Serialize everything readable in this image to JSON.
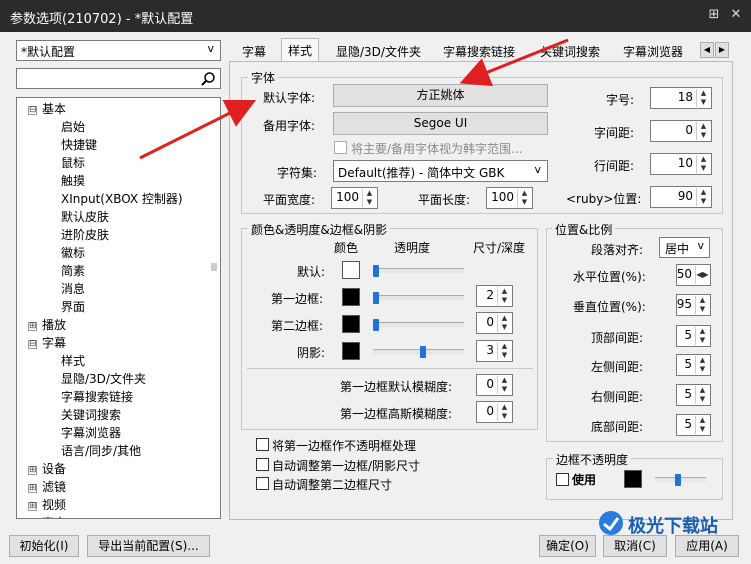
{
  "window": {
    "title": "参数选项(210702) - *默认配置",
    "pin_icon": "pin-icon",
    "close_icon": "close-icon"
  },
  "profile": {
    "selected": "*默认配置",
    "search_value": ""
  },
  "tree": [
    {
      "label": "基本",
      "expander": "⊟"
    },
    {
      "label": "启始"
    },
    {
      "label": "快捷键"
    },
    {
      "label": "鼠标"
    },
    {
      "label": "触摸"
    },
    {
      "label": "XInput(XBOX 控制器)"
    },
    {
      "label": "默认皮肤"
    },
    {
      "label": "进阶皮肤"
    },
    {
      "label": "徽标"
    },
    {
      "label": "简素"
    },
    {
      "label": "消息"
    },
    {
      "label": "界面"
    },
    {
      "label": "播放",
      "expander": "⊞"
    },
    {
      "label": "字幕",
      "expander": "⊟"
    },
    {
      "label": "样式"
    },
    {
      "label": "显隐/3D/文件夹"
    },
    {
      "label": "字幕搜索链接"
    },
    {
      "label": "关键词搜索"
    },
    {
      "label": "字幕浏览器"
    },
    {
      "label": "语言/同步/其他"
    },
    {
      "label": "设备",
      "expander": "⊞"
    },
    {
      "label": "滤镜",
      "expander": "⊞"
    },
    {
      "label": "视频",
      "expander": "⊞"
    },
    {
      "label": "声音",
      "expander": "⊞"
    }
  ],
  "tabs": [
    "字幕",
    "样式",
    "显隐/3D/文件夹",
    "字幕搜索链接",
    "关键词搜索",
    "字幕浏览器"
  ],
  "font": {
    "group": "字体",
    "default_label": "默认字体:",
    "default_value": "方正姚体",
    "backup_label": "备用字体:",
    "backup_value": "Segoe UI",
    "korean_checkbox": "将主要/备用字体视为韩字范围...",
    "charset_label": "字符集:",
    "charset_value": "Default(推荐) - 简体中文 GBK",
    "width_label": "平面宽度:",
    "width_value": "100",
    "length_label": "平面长度:",
    "length_value": "100",
    "size_label": "字号:",
    "size_value": "18",
    "spacing_label": "字间距:",
    "spacing_value": "0",
    "line_label": "行间距:",
    "line_value": "10",
    "ruby_label": "<ruby>位置:",
    "ruby_value": "90"
  },
  "colors": {
    "group": "颜色&透明度&边框&阴影",
    "col_color": "颜色",
    "col_opacity": "透明度",
    "col_size": "尺寸/深度",
    "rows": [
      {
        "label": "默认:",
        "color": "#ffffff",
        "opacity": 0.0,
        "size": ""
      },
      {
        "label": "第一边框:",
        "color": "#000000",
        "opacity": 0.0,
        "size": "2"
      },
      {
        "label": "第二边框:",
        "color": "#000000",
        "opacity": 0.0,
        "size": "0"
      },
      {
        "label": "阴影:",
        "color": "#000000",
        "opacity": 0.55,
        "size": "3"
      }
    ],
    "blur1_label": "第一边框默认模糊度:",
    "blur1_value": "0",
    "blur2_label": "第一边框高斯模糊度:",
    "blur2_value": "0"
  },
  "checks": [
    "将第一边框作不透明框处理",
    "自动调整第一边框/阴影尺寸",
    "自动调整第二边框尺寸"
  ],
  "position": {
    "group": "位置&比例",
    "align_label": "段落对齐:",
    "align_value": "居中",
    "h_label": "水平位置(%):",
    "h_value": "50",
    "v_label": "垂直位置(%):",
    "v_value": "95",
    "top_label": "顶部间距:",
    "top_value": "5",
    "left_label": "左侧间距:",
    "left_value": "5",
    "right_label": "右侧间距:",
    "right_value": "5",
    "bottom_label": "底部间距:",
    "bottom_value": "5"
  },
  "border_opacity": {
    "group": "边框不透明度",
    "use_label": "使用",
    "color": "#000000",
    "level": 0.45
  },
  "footer": {
    "init": "初始化(I)",
    "export": "导出当前配置(S)...",
    "ok": "确定(O)",
    "cancel": "取消(C)",
    "apply": "应用(A)"
  },
  "watermark": "极光下载站"
}
